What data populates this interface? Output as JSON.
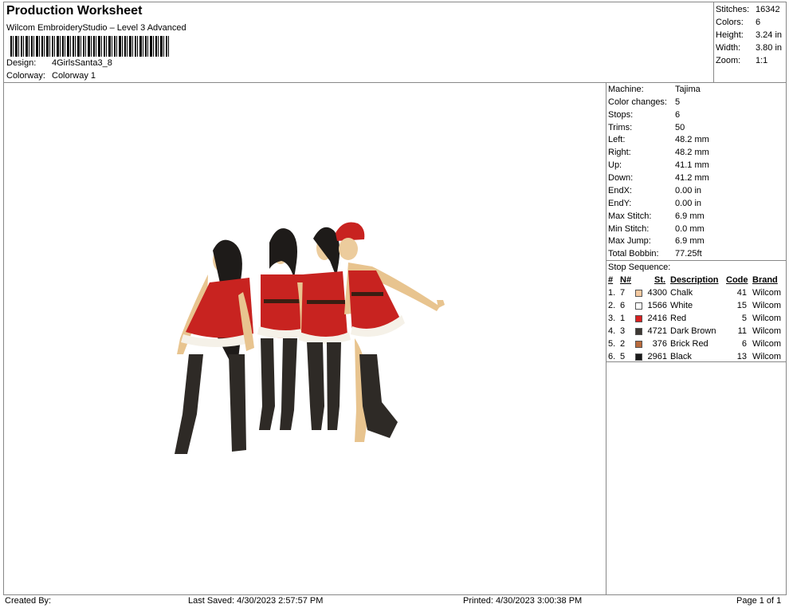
{
  "header": {
    "title": "Production Worksheet",
    "subtitle": "Wilcom EmbroideryStudio – Level 3 Advanced",
    "design_label": "Design:",
    "design_value": "4GirlsSanta3_8",
    "colorway_label": "Colorway:",
    "colorway_value": "Colorway 1"
  },
  "stats": [
    {
      "label": "Stitches:",
      "value": "16342"
    },
    {
      "label": "Colors:",
      "value": "6"
    },
    {
      "label": "Height:",
      "value": "3.24 in"
    },
    {
      "label": "Width:",
      "value": "3.80 in"
    },
    {
      "label": "Zoom:",
      "value": "1:1"
    }
  ],
  "machine_info": [
    {
      "label": "Machine:",
      "value": "Tajima"
    },
    {
      "label": "Color changes:",
      "value": "5"
    },
    {
      "label": "Stops:",
      "value": "6"
    },
    {
      "label": "Trims:",
      "value": "50"
    },
    {
      "label": "Left:",
      "value": "48.2 mm"
    },
    {
      "label": "Right:",
      "value": "48.2 mm"
    },
    {
      "label": "Up:",
      "value": "41.1 mm"
    },
    {
      "label": "Down:",
      "value": "41.2 mm"
    },
    {
      "label": "EndX:",
      "value": "0.00 in"
    },
    {
      "label": "EndY:",
      "value": "0.00 in"
    },
    {
      "label": "Max Stitch:",
      "value": "6.9 mm"
    },
    {
      "label": "Min Stitch:",
      "value": "0.0 mm"
    },
    {
      "label": "Max Jump:",
      "value": "6.9 mm"
    },
    {
      "label": "Total Bobbin:",
      "value": "77.25ft"
    }
  ],
  "stop_sequence": {
    "title": "Stop Sequence:",
    "headers": {
      "num": "#",
      "n": "N#",
      "st": "St.",
      "desc": "Description",
      "code": "Code",
      "brand": "Brand"
    },
    "rows": [
      {
        "num": "1.",
        "n": "7",
        "color": "#f5c9a0",
        "st": "4300",
        "desc": "Chalk",
        "code": "41",
        "brand": "Wilcom"
      },
      {
        "num": "2.",
        "n": "6",
        "color": "#ffffff",
        "st": "1566",
        "desc": "White",
        "code": "15",
        "brand": "Wilcom"
      },
      {
        "num": "3.",
        "n": "1",
        "color": "#d82020",
        "st": "2416",
        "desc": "Red",
        "code": "5",
        "brand": "Wilcom"
      },
      {
        "num": "4.",
        "n": "3",
        "color": "#3d3833",
        "st": "4721",
        "desc": "Dark Brown",
        "code": "11",
        "brand": "Wilcom"
      },
      {
        "num": "5.",
        "n": "2",
        "color": "#b86a3c",
        "st": "376",
        "desc": "Brick Red",
        "code": "6",
        "brand": "Wilcom"
      },
      {
        "num": "6.",
        "n": "5",
        "color": "#1a1a1a",
        "st": "2961",
        "desc": "Black",
        "code": "13",
        "brand": "Wilcom"
      }
    ]
  },
  "footer": {
    "created_by": "Created By:",
    "last_saved": "Last Saved: 4/30/2023 2:57:57 PM",
    "printed": "Printed: 4/30/2023 3:00:38 PM",
    "page": "Page 1 of 1"
  }
}
